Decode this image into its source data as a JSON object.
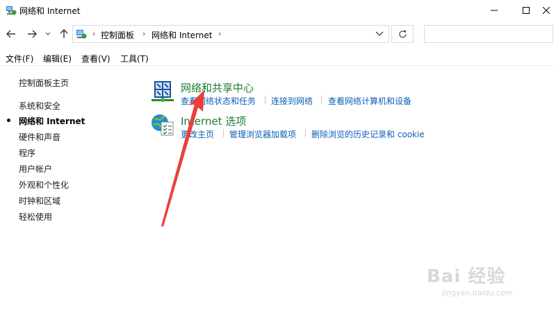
{
  "window": {
    "title": "网络和 Internet"
  },
  "address": {
    "crumbs": [
      "控制面板",
      "网络和 Internet"
    ],
    "separator": "›",
    "search_placeholder": ""
  },
  "menu": [
    "文件(F)",
    "编辑(E)",
    "查看(V)",
    "工具(T)"
  ],
  "sidebar": {
    "home": "控制面板主页",
    "items": [
      "系统和安全",
      "网络和 Internet",
      "硬件和声音",
      "程序",
      "用户帐户",
      "外观和个性化",
      "时钟和区域",
      "轻松使用"
    ],
    "active_index": 1
  },
  "categories": [
    {
      "title": "网络和共享中心",
      "icon": "network-sharing-icon",
      "links": [
        "查看网络状态和任务",
        "连接到网络",
        "查看网络计算机和设备"
      ]
    },
    {
      "title": "Internet 选项",
      "icon": "internet-options-icon",
      "links": [
        "更改主页",
        "管理浏览器加载项",
        "删除浏览的历史记录和 cookie"
      ]
    }
  ],
  "colors": {
    "category_title": "#1e7a32",
    "link": "#0b5fb4",
    "arrow": "#e8413a"
  },
  "watermark": {
    "logo": "Bai 经验",
    "url": "jingyan.baidu.com"
  }
}
